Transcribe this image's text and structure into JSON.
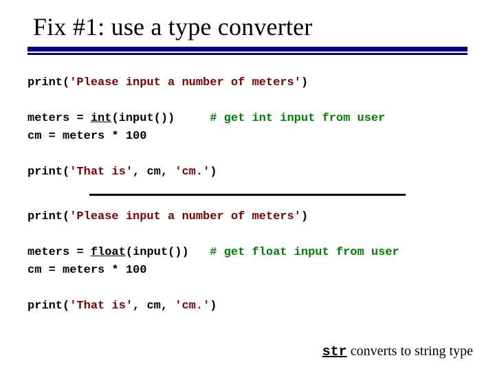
{
  "title": "Fix #1:  use a type converter",
  "block1": {
    "l1a": "print(",
    "l1b": "'Please input a number of meters'",
    "l1c": ")",
    "l2a": "meters = ",
    "l2fn": "int",
    "l2b": "(input())     ",
    "l2comment": "# get int input from user",
    "l3": "cm = meters * 100",
    "l4a": "print(",
    "l4b": "'That is'",
    "l4c": ", cm, ",
    "l4d": "'cm.'",
    "l4e": ")"
  },
  "block2": {
    "l1a": "print(",
    "l1b": "'Please input a number of meters'",
    "l1c": ")",
    "l2a": "meters = ",
    "l2fn": "float",
    "l2b": "(input())   ",
    "l2comment": "# get float input from user",
    "l3": "cm = meters * 100",
    "l4a": "print(",
    "l4b": "'That is'",
    "l4c": ", cm, ",
    "l4d": "'cm.'",
    "l4e": ")"
  },
  "footer": {
    "kw": "str",
    "text": " converts to string type"
  }
}
